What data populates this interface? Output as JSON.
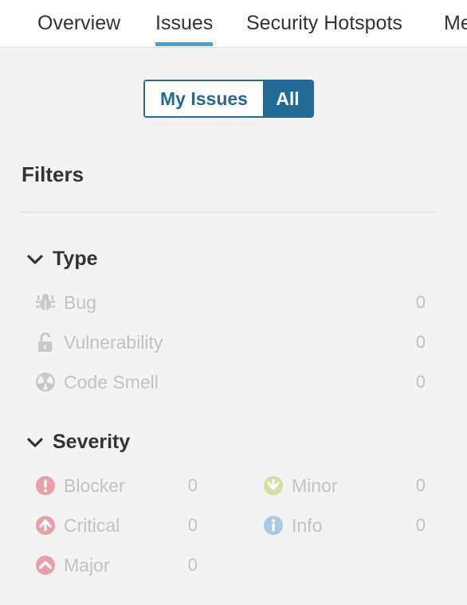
{
  "nav": {
    "tabs": [
      {
        "label": "Overview"
      },
      {
        "label": "Issues"
      },
      {
        "label": "Security Hotspots"
      },
      {
        "label": "Me"
      }
    ],
    "active_tab": "Issues"
  },
  "toggle": {
    "mine_label": "My Issues",
    "all_label": "All",
    "selected": "All"
  },
  "filters": {
    "title": "Filters",
    "type": {
      "label": "Type",
      "items": [
        {
          "label": "Bug",
          "count": "0",
          "icon": "bug-icon"
        },
        {
          "label": "Vulnerability",
          "count": "0",
          "icon": "lock-icon"
        },
        {
          "label": "Code Smell",
          "count": "0",
          "icon": "code-smell-icon"
        }
      ]
    },
    "severity": {
      "label": "Severity",
      "items": [
        {
          "label": "Blocker",
          "count": "0",
          "icon": "blocker-icon",
          "color": "#d4333f"
        },
        {
          "label": "Minor",
          "count": "0",
          "icon": "minor-icon",
          "color": "#8eb325"
        },
        {
          "label": "Critical",
          "count": "0",
          "icon": "critical-icon",
          "color": "#d4333f"
        },
        {
          "label": "Info",
          "count": "0",
          "icon": "info-icon",
          "color": "#4b9fd5"
        },
        {
          "label": "Major",
          "count": "0",
          "icon": "major-icon",
          "color": "#d4333f"
        }
      ]
    }
  },
  "colors": {
    "accent": "#236a97",
    "tab_underline": "#4b9fd5",
    "muted_text": "#c2c2c2"
  }
}
